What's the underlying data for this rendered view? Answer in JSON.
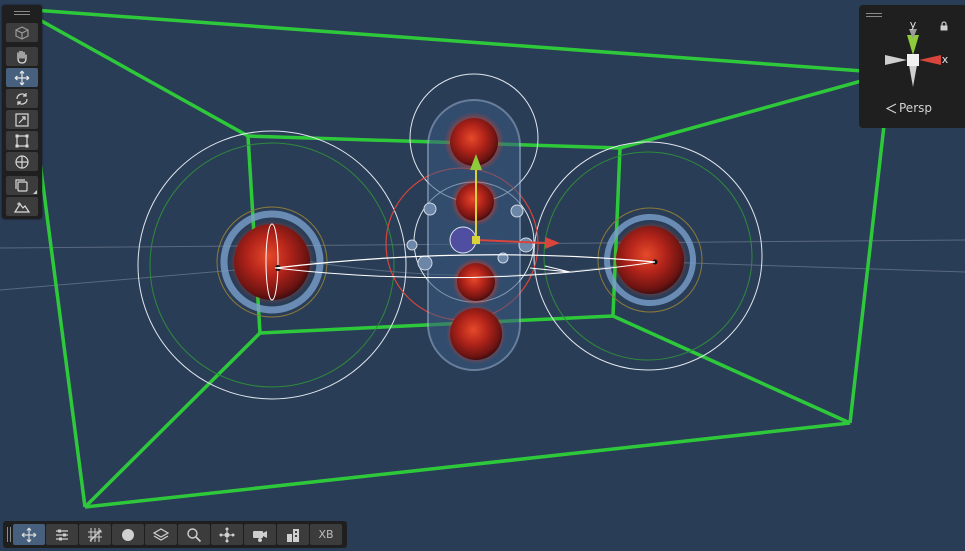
{
  "window": {
    "camera_mode": "Persp"
  },
  "colors": {
    "background": "#2a3d56",
    "bounds_box": "#2ec93a",
    "axis_x": "#d8453c",
    "axis_y": "#8ecb3c",
    "panel": "#1f1f1f",
    "button": "#3c3c3c",
    "button_active": "#46607e"
  },
  "tools": {
    "items": [
      {
        "name": "view-tool",
        "icon": "cube-icon",
        "active": false
      },
      {
        "name": "hand-tool",
        "icon": "hand-icon",
        "active": false
      },
      {
        "name": "move-tool",
        "icon": "move-arrows-icon",
        "active": true
      },
      {
        "name": "rotate-tool",
        "icon": "rotate-icon",
        "active": false
      },
      {
        "name": "scale-tool",
        "icon": "scale-icon",
        "active": false
      },
      {
        "name": "rect-tool",
        "icon": "rect-transform-icon",
        "active": false
      },
      {
        "name": "transform-tool",
        "icon": "transform-icon",
        "active": false
      },
      {
        "name": "custom-tools",
        "icon": "layers-icon",
        "active": false
      },
      {
        "name": "component-tool",
        "icon": "terrain-icon",
        "active": false
      }
    ]
  },
  "gizmo": {
    "y_label": "y",
    "x_label": "x",
    "persp_label": "Persp"
  },
  "overlay_bar": {
    "items": [
      {
        "name": "move-overlay",
        "icon": "move-arrows-icon",
        "active": true
      },
      {
        "name": "tool-settings",
        "icon": "sliders-icon"
      },
      {
        "name": "grid-snapping",
        "icon": "grid-icon"
      },
      {
        "name": "draw-mode",
        "icon": "circle-icon"
      },
      {
        "name": "layers-overlay",
        "icon": "layers-icon"
      },
      {
        "name": "search-overlay",
        "icon": "search-icon"
      },
      {
        "name": "pivot-overlay",
        "icon": "pivot-icon"
      },
      {
        "name": "camera-overlay",
        "icon": "camera-icon"
      },
      {
        "name": "buildings-overlay",
        "icon": "building-icon"
      },
      {
        "name": "xb-overlay",
        "label": "XB"
      }
    ]
  }
}
